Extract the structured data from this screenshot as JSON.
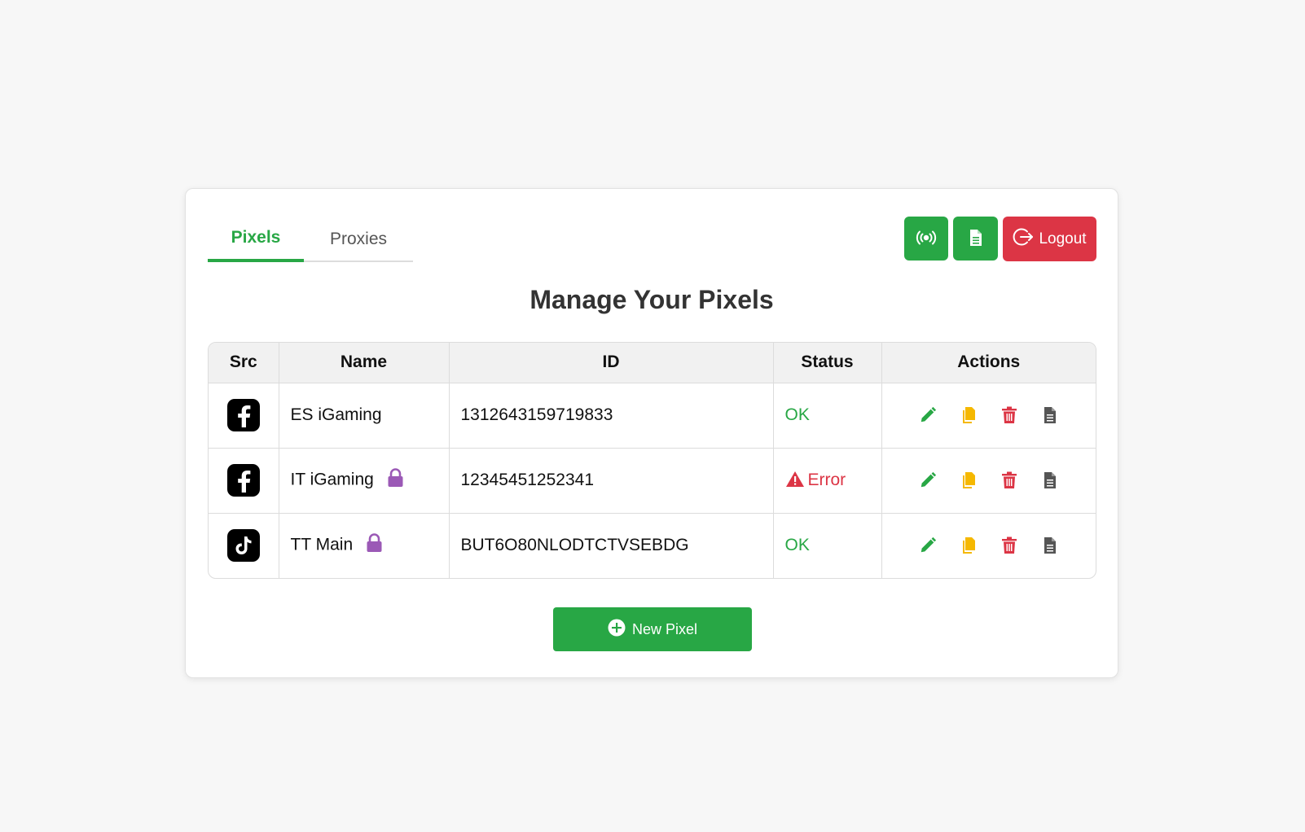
{
  "tabs": [
    {
      "label": "Pixels",
      "active": true
    },
    {
      "label": "Proxies",
      "active": false
    }
  ],
  "header_actions": {
    "broadcast_icon": "broadcast-icon",
    "document_icon": "document-icon",
    "logout_label": "Logout"
  },
  "page": {
    "title": "Manage Your Pixels"
  },
  "table": {
    "columns": [
      "Src",
      "Name",
      "ID",
      "Status",
      "Actions"
    ],
    "rows": [
      {
        "src": "facebook",
        "name": "ES iGaming",
        "locked": false,
        "id": "1312643159719833",
        "status": "OK",
        "status_type": "ok"
      },
      {
        "src": "facebook",
        "name": "IT iGaming",
        "locked": true,
        "id": "12345451252341",
        "status": "Error",
        "status_type": "error"
      },
      {
        "src": "tiktok",
        "name": "TT Main",
        "locked": true,
        "id": "BUT6O80NLODTCTVSEBDG",
        "status": "OK",
        "status_type": "ok"
      }
    ]
  },
  "new_pixel": {
    "label": "New Pixel"
  },
  "colors": {
    "green": "#28a745",
    "red": "#dc3545",
    "yellow": "#f5b800",
    "purple": "#9b59b6",
    "gray": "#555555"
  }
}
